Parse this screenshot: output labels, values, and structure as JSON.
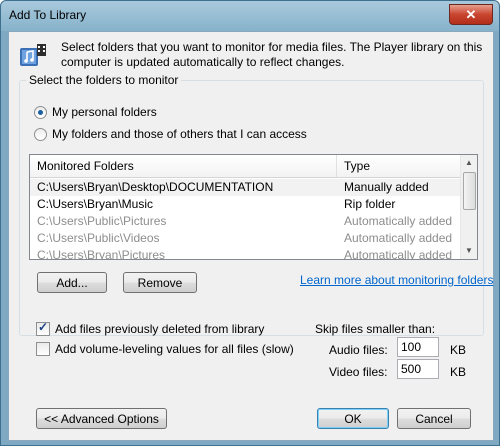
{
  "window": {
    "title": "Add To Library",
    "close_glyph": "✕"
  },
  "intro": {
    "text": "Select folders that you want to monitor for media files. The Player library on this computer is updated automatically to reflect changes."
  },
  "monitor_group": {
    "title": "Select the folders to monitor",
    "options": [
      {
        "label": "My personal folders",
        "selected": true
      },
      {
        "label": "My folders and those of others that I can access",
        "selected": false
      }
    ]
  },
  "folders": {
    "columns": [
      "Monitored Folders",
      "Type"
    ],
    "rows": [
      {
        "path": "C:\\Users\\Bryan\\Desktop\\DOCUMENTATION",
        "type": "Manually added"
      },
      {
        "path": "C:\\Users\\Bryan\\Music",
        "type": "Rip folder"
      },
      {
        "path": "C:\\Users\\Public\\Pictures",
        "type": "Automatically added"
      },
      {
        "path": "C:\\Users\\Public\\Videos",
        "type": "Automatically added"
      },
      {
        "path": "C:\\Users\\Bryan\\Pictures",
        "type": "Automatically added"
      }
    ]
  },
  "buttons": {
    "add": "Add...",
    "remove": "Remove",
    "advanced": "<< Advanced Options",
    "ok": "OK",
    "cancel": "Cancel"
  },
  "learn_more_link": "Learn more about monitoring folders",
  "options": {
    "add_deleted": {
      "label": "Add files previously deleted from library",
      "checked": true
    },
    "volume_leveling": {
      "label": "Add volume-leveling values for all files (slow)",
      "checked": false
    }
  },
  "skip": {
    "label": "Skip files smaller than:",
    "audio_label": "Audio files:",
    "audio_value": "100",
    "video_label": "Video files:",
    "video_value": "500",
    "unit": "KB"
  },
  "colors": {
    "accent": "#3c7fb1",
    "link": "#0066cc",
    "titlebar": "#86b2cb",
    "close": "#c8452f"
  }
}
